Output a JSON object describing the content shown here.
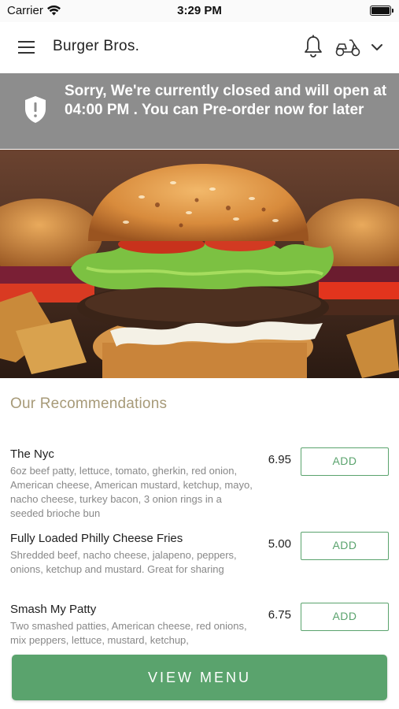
{
  "status_bar": {
    "carrier": "Carrier",
    "time": "3:29 PM"
  },
  "header": {
    "brand": "Burger Bros.",
    "icons": [
      "hamburger-menu-icon",
      "bell-icon",
      "scooter-icon",
      "chevron-down-icon"
    ]
  },
  "banner": {
    "message": "Sorry, We're currently closed and will open at 04:00 PM . You can Pre-order now for later",
    "icon": "shield-alert-icon",
    "background": "#8d8d8d"
  },
  "recommendations": {
    "title": "Our Recommendations",
    "items": [
      {
        "name": "The Nyc",
        "description": "6oz beef patty, lettuce, tomato, gherkin, red onion, American cheese, American mustard, ketchup, mayo, nacho cheese, turkey bacon, 3 onion rings in a seeded brioche bun",
        "price": "6.95",
        "button": "ADD"
      },
      {
        "name": "Fully Loaded Philly Cheese Fries",
        "description": "Shredded beef, nacho cheese, jalapeno, peppers, onions, ketchup and mustard. Great for sharing",
        "price": "5.00",
        "button": "ADD"
      },
      {
        "name": "Smash My Patty",
        "description": "Two smashed patties, American cheese, red onions, mix peppers, lettuce, mustard, ketchup,",
        "price": "6.75",
        "button": "ADD"
      }
    ]
  },
  "footer": {
    "view_menu_label": "VIEW MENU"
  },
  "colors": {
    "accent": "#5aa36d",
    "section_title": "#a79a78"
  }
}
